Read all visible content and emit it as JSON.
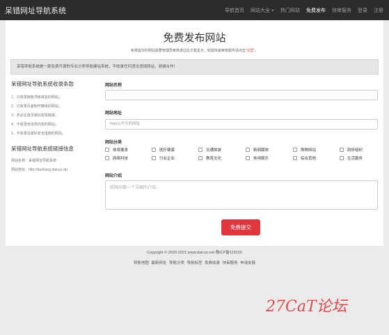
{
  "header": {
    "brand": "呆错网址导航系统",
    "nav": [
      {
        "label": "导航首页",
        "active": false,
        "dropdown": false
      },
      {
        "label": "网站大全",
        "active": false,
        "dropdown": true
      },
      {
        "label": "热门网站",
        "active": false,
        "dropdown": false
      },
      {
        "label": "免费发布",
        "active": true,
        "dropdown": false
      },
      {
        "label": "快审服务",
        "active": false,
        "dropdown": false
      },
      {
        "label": "登录",
        "active": false,
        "dropdown": false
      },
      {
        "label": "注册",
        "active": false,
        "dropdown": false
      }
    ]
  },
  "page": {
    "title": "免费发布网站",
    "subtitle_pre": "免费提交的网站需要管理员审核通过后才能显示，如需快速审核服务请点击“",
    "subtitle_link": "这里",
    "subtitle_post": "”。",
    "notice": "呆错导航系统是一款免费开源的专业分类导航建站系统，不收录任何违法违规网站，谢谢合作！"
  },
  "sidebar": {
    "rules_title": "呆错网址导航系统收录条款",
    "rules": [
      "1、只收录拥有顶级域名的网站；",
      "2、只收录页面制作精良的网站；",
      "3、务必在首页做好友情链接；",
      "4、不收录含违规内容的网站；",
      "5、不收录没做好安全措施的网站。"
    ],
    "links_title": "呆错网址导航系统链接信息",
    "site_name": "网站名称：呆错网址导航系统",
    "site_url": "网站地址：http://daohang.daicuo.vip"
  },
  "form": {
    "name_label": "网站名称",
    "name_value": "",
    "url_label": "网站地址",
    "url_placeholder": "http(s)开头的网址",
    "cat_label": "网站分类",
    "categories": [
      "体育健身",
      "医疗健康",
      "交通旅游",
      "新闻媒体",
      "购物网站",
      "政府组织",
      "网络科技",
      "行业企业",
      "教育文化",
      "休闲娱乐",
      "综合其他",
      "生活服务"
    ],
    "intro_label": "网站介绍",
    "intro_placeholder": "给网站做一个详细的介绍...",
    "submit_label": "免费提交"
  },
  "footer": {
    "copyright": "Copyright © 2020-2021 www.daicuo.net 豫ICP备119120",
    "links": [
      "导航地图",
      "最新网址",
      "导航分类",
      "导航标签",
      "免费收录",
      "快审服务",
      "申请友链"
    ]
  },
  "watermark": "27CaT论坛"
}
